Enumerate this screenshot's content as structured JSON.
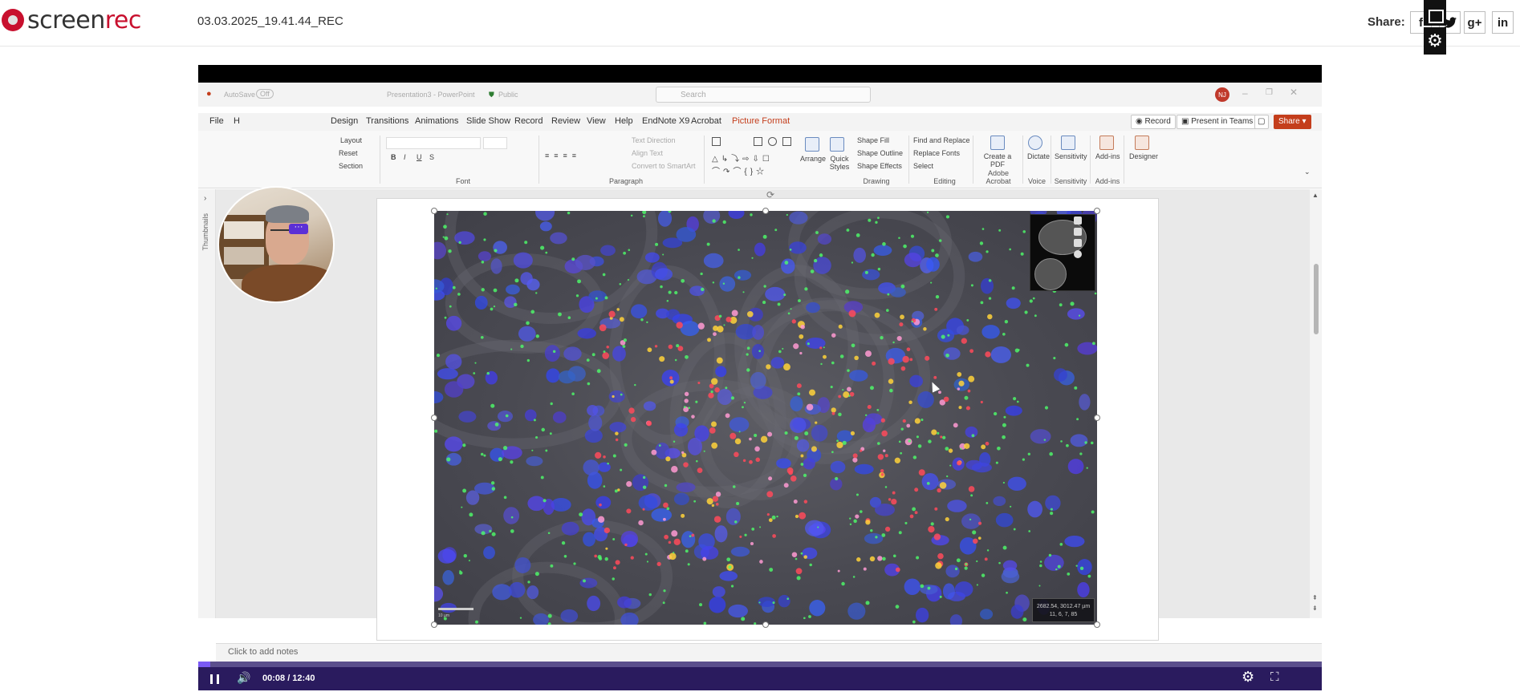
{
  "app": {
    "brand_prefix": "screen",
    "brand_suffix": "rec",
    "file_name": "03.03.2025_19.41.44_REC"
  },
  "share": {
    "label": "Share:",
    "buttons": [
      {
        "name": "facebook",
        "glyph": "f"
      },
      {
        "name": "twitter",
        "glyph": "t"
      },
      {
        "name": "google-plus",
        "glyph": "g+"
      },
      {
        "name": "linkedin",
        "glyph": "in"
      }
    ]
  },
  "ppt": {
    "titlebar": {
      "autosave": "AutoSave",
      "autosave_state": "Off",
      "doc": "Presentation3 - PowerPoint",
      "sensitivity": "Public",
      "search": "Search",
      "avatar": "NJ"
    },
    "menu": [
      "File",
      "H",
      "Design",
      "Transitions",
      "Animations",
      "Slide Show",
      "Record",
      "Review",
      "View",
      "Help",
      "EndNote X9",
      "Acrobat",
      "Picture Format"
    ],
    "menu_right": {
      "record": "Record",
      "present": "Present in Teams",
      "share": "Share"
    },
    "ribbon": {
      "slides_group": [
        "Layout",
        "Reset",
        "Section"
      ],
      "font_group": "Font",
      "paragraph_group": "Paragraph",
      "paragraph_items": [
        "Text Direction",
        "Align Text",
        "Convert to SmartArt"
      ],
      "drawing_group": "Drawing",
      "drawing_items": [
        "Arrange",
        "Quick Styles",
        "Shape Fill",
        "Shape Outline",
        "Shape Effects"
      ],
      "editing_group": "Editing",
      "editing_items": [
        "Find and Replace",
        "Replace Fonts",
        "Select"
      ],
      "adobe": {
        "label": "Create a PDF",
        "group": "Adobe Acrobat"
      },
      "voice": {
        "label": "Dictate",
        "group": "Voice"
      },
      "sensitivity": {
        "label": "Sensitivity",
        "group": "Sensitivity"
      },
      "addins": {
        "label": "Add-ins",
        "group": "Add-ins"
      },
      "designer": {
        "label": "Designer"
      }
    },
    "thumbnails_label": "Thumbnails",
    "notes_placeholder": "Click to add notes",
    "micro": {
      "coords_line1": "2682.54, 3012.47 µm",
      "coords_line2": "11, 6, 7, 85",
      "scale": "10 µm"
    }
  },
  "player": {
    "time": "00:08 / 12:40",
    "progress": 0.011
  },
  "colors": {
    "brand": "#c8102e",
    "player_bg": "#2a1b5e",
    "progress": "#7a5af5",
    "ppt_accent": "#c43e1c"
  }
}
